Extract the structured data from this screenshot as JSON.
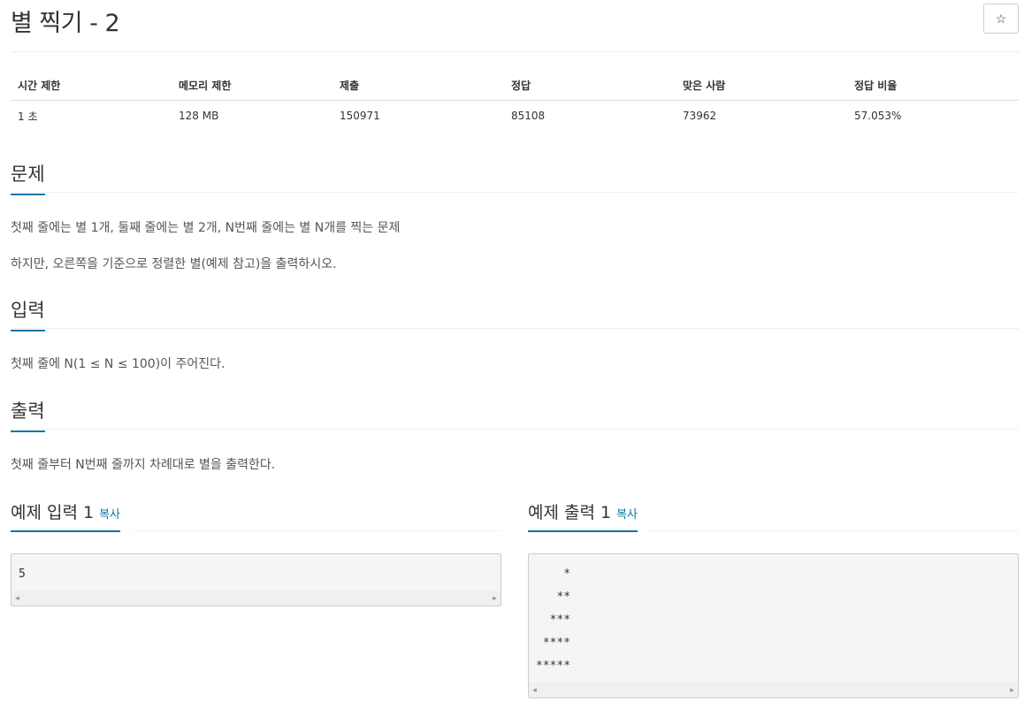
{
  "problem": {
    "title": "별 찍기 - 2",
    "star_icon": "☆"
  },
  "info_table": {
    "headers": [
      "시간 제한",
      "메모리 제한",
      "제출",
      "정답",
      "맞은 사람",
      "정답 비율"
    ],
    "values": [
      "1 초",
      "128 MB",
      "150971",
      "85108",
      "73962",
      "57.053%"
    ]
  },
  "sections": {
    "problem": {
      "heading": "문제",
      "lines": [
        "첫째 줄에는 별 1개, 둘째 줄에는 별 2개, N번째 줄에는 별 N개를 찍는 문제",
        "하지만, 오른쪽을 기준으로 정렬한 별(예제 참고)을 출력하시오."
      ]
    },
    "input": {
      "heading": "입력",
      "lines": [
        "첫째 줄에 N(1 ≤ N ≤ 100)이 주어진다."
      ]
    },
    "output": {
      "heading": "출력",
      "lines": [
        "첫째 줄부터 N번째 줄까지 차례대로 별을 출력한다."
      ]
    }
  },
  "samples": {
    "input": {
      "heading": "예제 입력 1",
      "copy_label": "복사",
      "content": "5"
    },
    "output": {
      "heading": "예제 출력 1",
      "copy_label": "복사",
      "content": "    *\n   **\n  ***\n ****\n*****"
    }
  },
  "icons": {
    "scroll_left": "◀",
    "scroll_right": "▶"
  },
  "colors": {
    "accent": "#0e76a8",
    "text": "#333333",
    "pre_background": "#f5f5f5"
  }
}
